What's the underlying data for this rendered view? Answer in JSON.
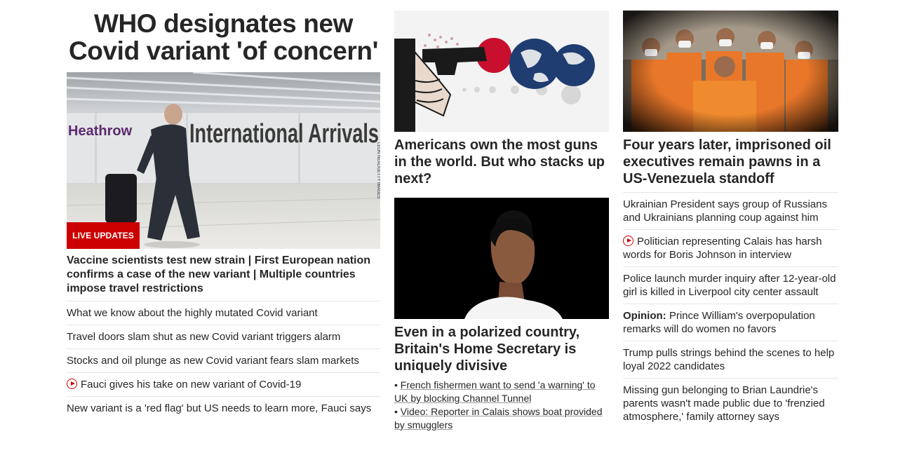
{
  "left": {
    "headline": "WHO designates new Covid variant 'of concern'",
    "hero_image": {
      "sign_text": "Heathrow International Arrivals",
      "credit": "LEON NEAL/GETTY IMAGES"
    },
    "badge": "LIVE UPDATES",
    "lead": "Vaccine scientists test new strain | First European nation confirms a case of the new variant | Multiple countries impose travel restrictions",
    "links": [
      {
        "text": "What we know about the highly mutated Covid variant",
        "video": false
      },
      {
        "text": "Travel doors slam shut as new Covid variant triggers alarm",
        "video": false
      },
      {
        "text": "Stocks and oil plunge as new Covid variant fears slam markets",
        "video": false
      },
      {
        "text": "Fauci gives his take on new variant of Covid-19",
        "video": true
      },
      {
        "text": "New variant is a 'red flag' but US needs to learn more, Fauci says",
        "video": false
      }
    ]
  },
  "middle": {
    "card1": {
      "headline": "Americans own the most guns in the world. But who stacks up next?"
    },
    "card2": {
      "headline": "Even in a polarized country, Britain's Home Secretary is uniquely divisive",
      "sublinks": [
        "French fishermen want to send 'a warning' to UK by blocking Channel Tunnel",
        "Video: Reporter in Calais shows boat provided by smugglers"
      ]
    }
  },
  "right": {
    "headline": "Four years later, imprisoned oil executives remain pawns in a US-Venezuela standoff",
    "links": [
      {
        "prefix": "",
        "text": "Ukrainian President says group of Russians and Ukrainians planning coup against him",
        "video": false
      },
      {
        "prefix": "",
        "text": "Politician representing Calais has harsh words for Boris Johnson in interview",
        "video": true
      },
      {
        "prefix": "",
        "text": "Police launch murder inquiry after 12-year-old girl is killed in Liverpool city center assault",
        "video": false
      },
      {
        "prefix": "Opinion:",
        "text": "Prince William's overpopulation remarks will do women no favors",
        "video": false
      },
      {
        "prefix": "",
        "text": "Trump pulls strings behind the scenes to help loyal 2022 candidates",
        "video": false
      },
      {
        "prefix": "",
        "text": "Missing gun belonging to Brian Laundrie's parents wasn't made public due to 'frenzied atmosphere,' family attorney says",
        "video": false
      }
    ]
  },
  "colors": {
    "accent": "#cc0000",
    "text": "#262626",
    "divider": "#e6e6e6"
  }
}
